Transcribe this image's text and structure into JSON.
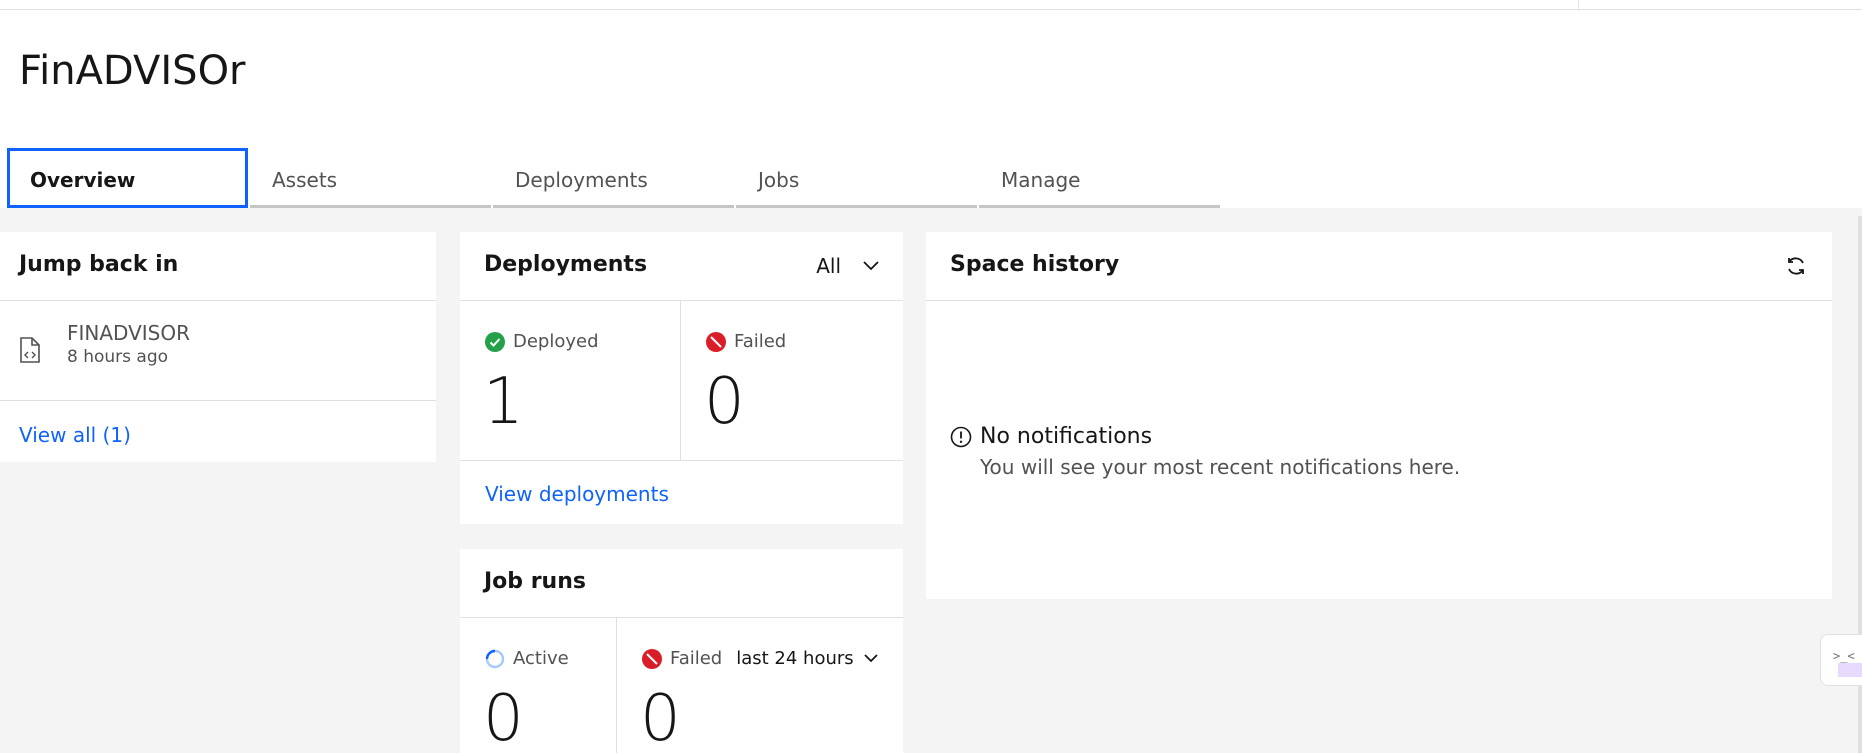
{
  "project": {
    "title": "FinADVISOr"
  },
  "tabs": [
    {
      "label": "Overview",
      "active": true
    },
    {
      "label": "Assets"
    },
    {
      "label": "Deployments"
    },
    {
      "label": "Jobs"
    },
    {
      "label": "Manage"
    }
  ],
  "jump": {
    "title": "Jump back in",
    "items": [
      {
        "name": "FINADVISOR",
        "time": "8 hours ago",
        "icon": "code-file-icon"
      }
    ],
    "view_all": "View all (1)"
  },
  "deployments": {
    "title": "Deployments",
    "filter": "All",
    "deployed": {
      "label": "Deployed",
      "value": "1",
      "color": "#24a148"
    },
    "failed": {
      "label": "Failed",
      "value": "0",
      "color": "#da1e28"
    },
    "link": "View deployments"
  },
  "job_runs": {
    "title": "Job runs",
    "active": {
      "label": "Active",
      "value": "0"
    },
    "failed": {
      "label": "Failed",
      "range": "last 24 hours",
      "value": "0"
    }
  },
  "history": {
    "title": "Space history",
    "empty_title": "No notifications",
    "empty_sub": "You will see your most recent notifications here."
  },
  "side_widget": {
    "text": ">_<"
  },
  "colors": {
    "accent": "#0f62fe",
    "success": "#24a148",
    "error": "#da1e28"
  }
}
